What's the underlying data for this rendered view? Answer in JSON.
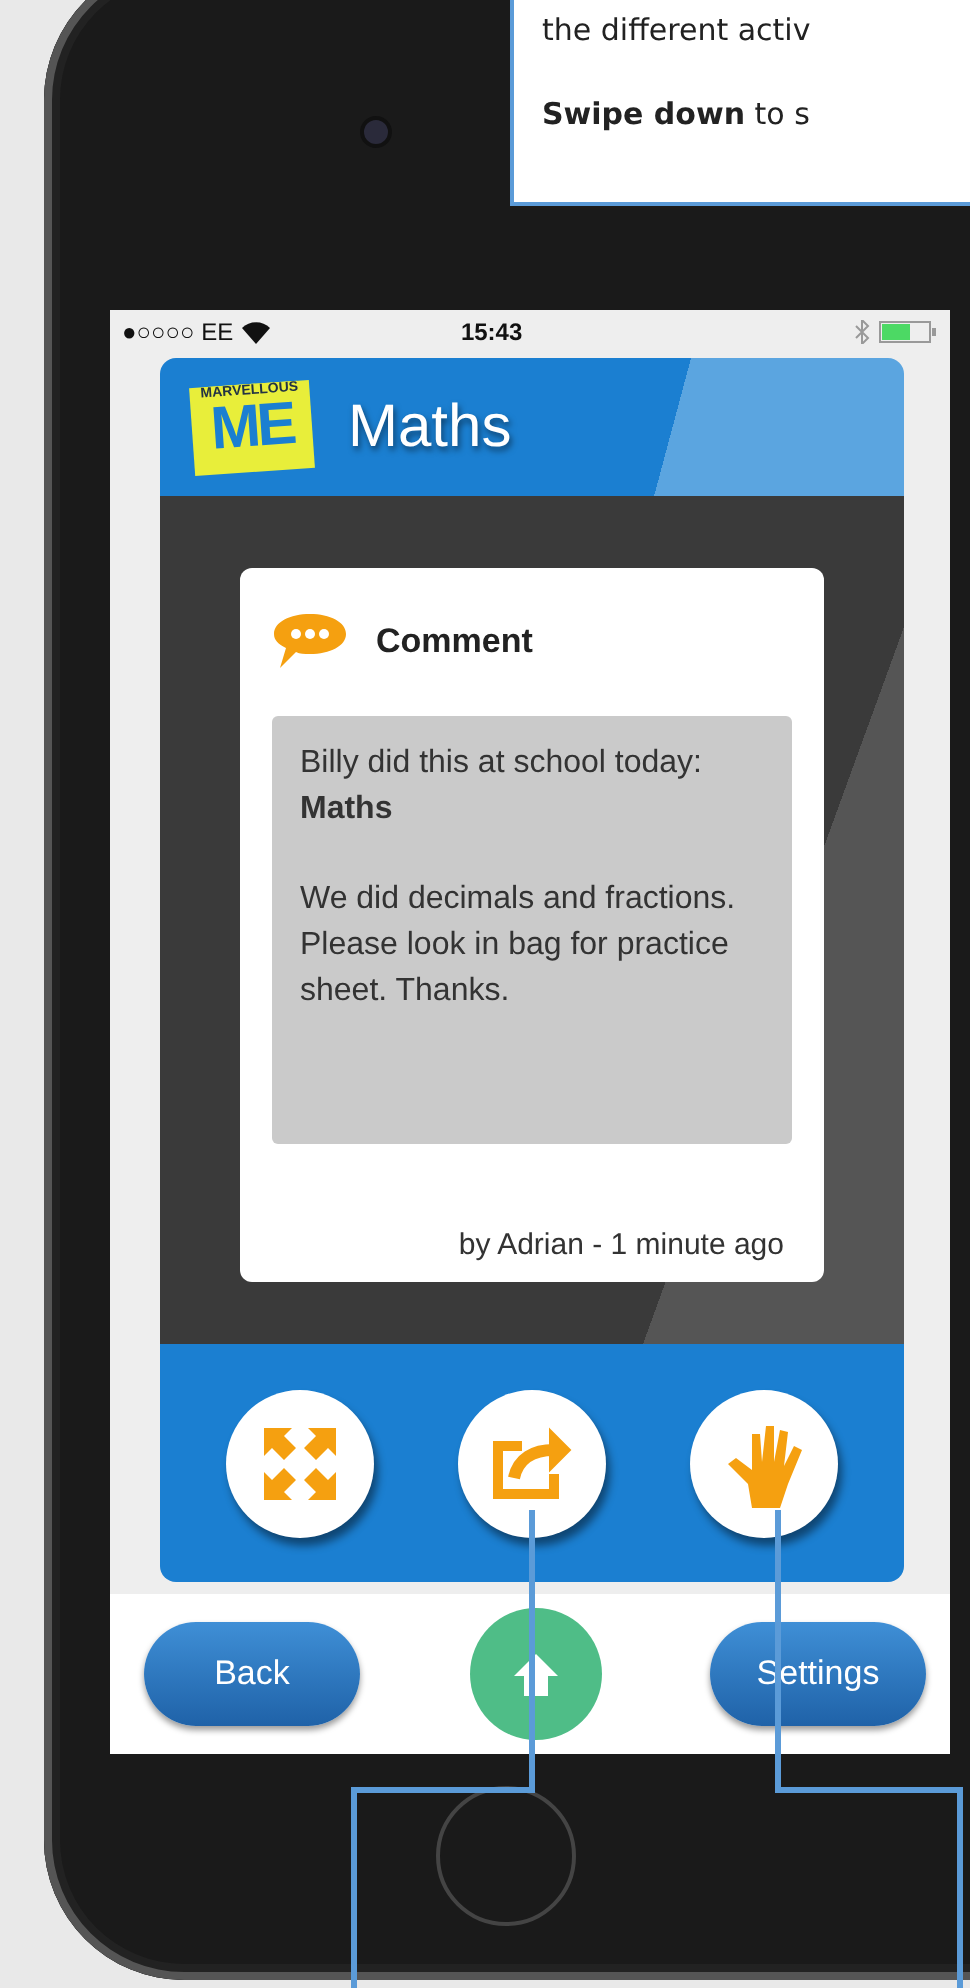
{
  "callout": {
    "lines": [
      "the different activ",
      "**Swipe down** to s"
    ]
  },
  "status_bar": {
    "carrier": "●○○○○ EE",
    "time": "15:43"
  },
  "header": {
    "logo_top": "MARVELLOUS",
    "logo_main": "ME",
    "title": "Maths"
  },
  "card": {
    "type": "Comment",
    "message": [
      "Billy did this at school today: **Maths**",
      "We did decimals and fractions. Please look in bag for practice sheet. Thanks."
    ],
    "byline": "by Adrian - 1 minute ago"
  },
  "actions": [
    {
      "kind": "expand"
    },
    {
      "kind": "share"
    },
    {
      "kind": "high-five"
    }
  ],
  "nav": {
    "back": "Back",
    "settings": "Settings"
  }
}
